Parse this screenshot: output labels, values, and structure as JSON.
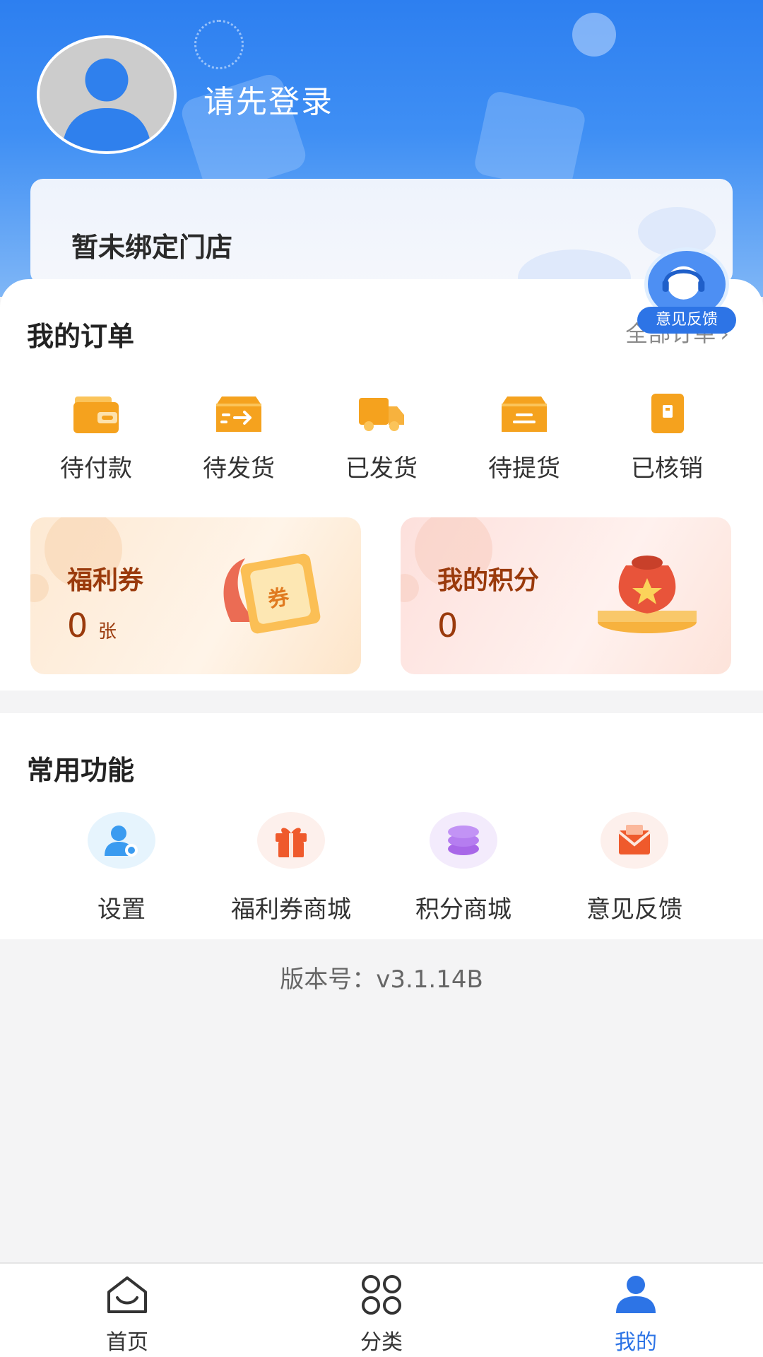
{
  "header": {
    "login_prompt": "请先登录",
    "store_status": "暂未绑定门店"
  },
  "orders": {
    "title": "我的订单",
    "all_link": "全部订单",
    "items": [
      {
        "label": "待付款",
        "icon": "wallet-icon"
      },
      {
        "label": "待发货",
        "icon": "box-arrow-icon"
      },
      {
        "label": "已发货",
        "icon": "truck-icon"
      },
      {
        "label": "待提货",
        "icon": "pickup-box-icon"
      },
      {
        "label": "已核销",
        "icon": "verified-doc-icon"
      }
    ]
  },
  "coupon": {
    "title": "福利券",
    "value": "0",
    "unit": "张",
    "art_text": "券"
  },
  "points": {
    "title": "我的积分",
    "value": "0"
  },
  "functions": {
    "title": "常用功能",
    "items": [
      {
        "label": "设置",
        "icon": "user-settings-icon"
      },
      {
        "label": "福利券商城",
        "icon": "gift-icon"
      },
      {
        "label": "积分商城",
        "icon": "coin-stack-icon"
      },
      {
        "label": "意见反馈",
        "icon": "envelope-icon"
      }
    ]
  },
  "version": "版本号：v3.1.14B",
  "float_feedback": {
    "label": "意见反馈"
  },
  "tabbar": {
    "items": [
      {
        "label": "首页",
        "icon": "home-icon",
        "active": false
      },
      {
        "label": "分类",
        "icon": "category-icon",
        "active": false
      },
      {
        "label": "我的",
        "icon": "profile-icon",
        "active": true
      }
    ]
  },
  "colors": {
    "header_blue": "#2d7ff0",
    "accent_blue": "#2d74e6",
    "order_orange": "#f5a21e",
    "promo_text": "#9a3a0c"
  }
}
